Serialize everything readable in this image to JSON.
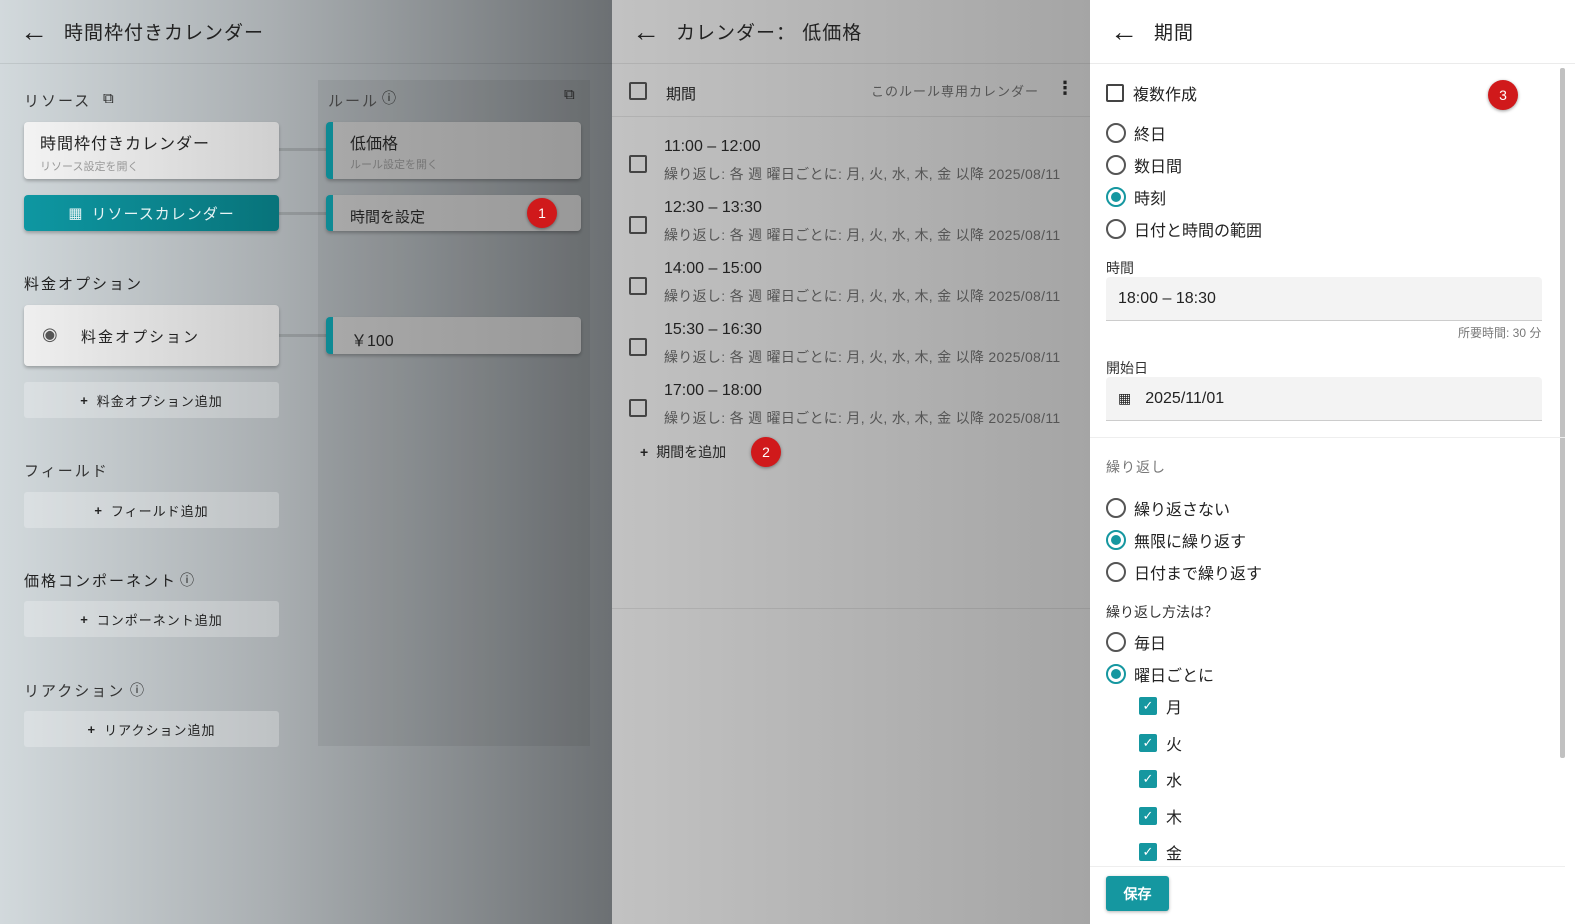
{
  "left": {
    "title": "時間枠付きカレンダー",
    "resources_label": "リソース",
    "resource_card": {
      "title": "時間枠付きカレンダー",
      "sub": "リソース設定を開く"
    },
    "resource_calendar_button": "リソースカレンダー",
    "rules_label": "ルール",
    "rule_card": {
      "title": "低価格",
      "sub": "ルール設定を開く"
    },
    "set_time": "時間を設定",
    "price_options_label": "料金オプション",
    "price_option_card": "料金オプション",
    "price_value": "￥100",
    "add_price_option": "料金オプション追加",
    "fields_label": "フィールド",
    "add_field": "フィールド追加",
    "components_label": "価格コンポーネント",
    "add_component": "コンポーネント追加",
    "reactions_label": "リアクション",
    "add_reaction": "リアクション追加",
    "badge1": "1"
  },
  "middle": {
    "title": "カレンダー： 低価格",
    "column": "期間",
    "calendar_note": "このルール専用カレンダー",
    "rows": [
      {
        "time": "11:00 – 12:00",
        "sub": "繰り返し: 各 週 曜日ごとに: 月, 火, 水, 木, 金 以降 2025/08/11"
      },
      {
        "time": "12:30 – 13:30",
        "sub": "繰り返し: 各 週 曜日ごとに: 月, 火, 水, 木, 金 以降 2025/08/11"
      },
      {
        "time": "14:00 – 15:00",
        "sub": "繰り返し: 各 週 曜日ごとに: 月, 火, 水, 木, 金 以降 2025/08/11"
      },
      {
        "time": "15:30 – 16:30",
        "sub": "繰り返し: 各 週 曜日ごとに: 月, 火, 水, 木, 金 以降 2025/08/11"
      },
      {
        "time": "17:00 – 18:00",
        "sub": "繰り返し: 各 週 曜日ごとに: 月, 火, 水, 木, 金 以降 2025/08/11"
      }
    ],
    "add_period": "期間を追加",
    "badge2": "2"
  },
  "right": {
    "title": "期間",
    "multi_create": "複数作成",
    "badge3": "3",
    "types": [
      "終日",
      "数日間",
      "時刻",
      "日付と時間の範囲"
    ],
    "time_label": "時間",
    "time_value": "18:00 – 18:30",
    "duration": "所要時間: 30 分",
    "start_label": "開始日",
    "start_value": "2025/11/01",
    "repeat_label": "繰り返し",
    "repeat_options": [
      "繰り返さない",
      "無限に繰り返す",
      "日付まで繰り返す"
    ],
    "how_label": "繰り返し方法は？",
    "how_options": [
      "毎日",
      "曜日ごとに"
    ],
    "days": [
      "月",
      "火",
      "水",
      "木",
      "金"
    ],
    "save": "保存"
  },
  "colors": {
    "accent": "#1597a0",
    "badge": "#d0191b"
  }
}
